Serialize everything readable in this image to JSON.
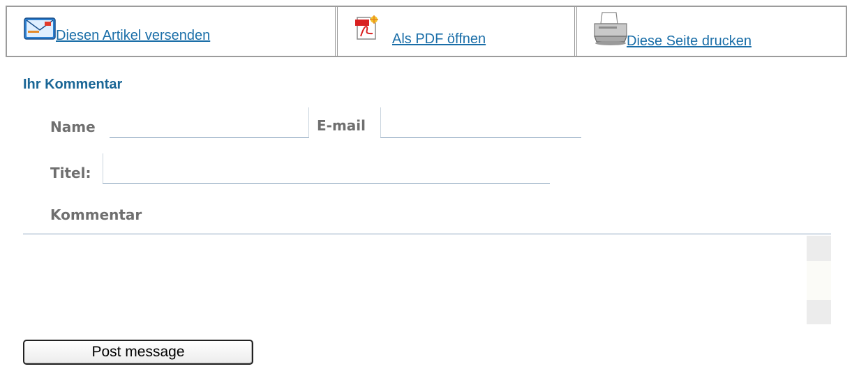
{
  "actions": {
    "send_article": {
      "label": "Diesen Artikel versenden",
      "icon": "envelope-icon"
    },
    "open_pdf": {
      "label": "Als PDF öffnen",
      "icon": "pdf-icon"
    },
    "print_page": {
      "label": "Diese Seite drucken",
      "icon": "printer-icon"
    }
  },
  "form": {
    "section_title": "Ihr Kommentar",
    "name_label": "Name",
    "name_value": "",
    "email_label": "E-mail",
    "email_value": "",
    "title_label": "Titel:",
    "title_value": "",
    "comment_label": "Kommentar",
    "comment_value": "",
    "submit_label": "Post message"
  },
  "colors": {
    "link": "#1a6ea8",
    "heading": "#1a6696",
    "label": "#6f6f6f",
    "border": "#9c9c9c",
    "field_line": "#8aa4bd"
  }
}
